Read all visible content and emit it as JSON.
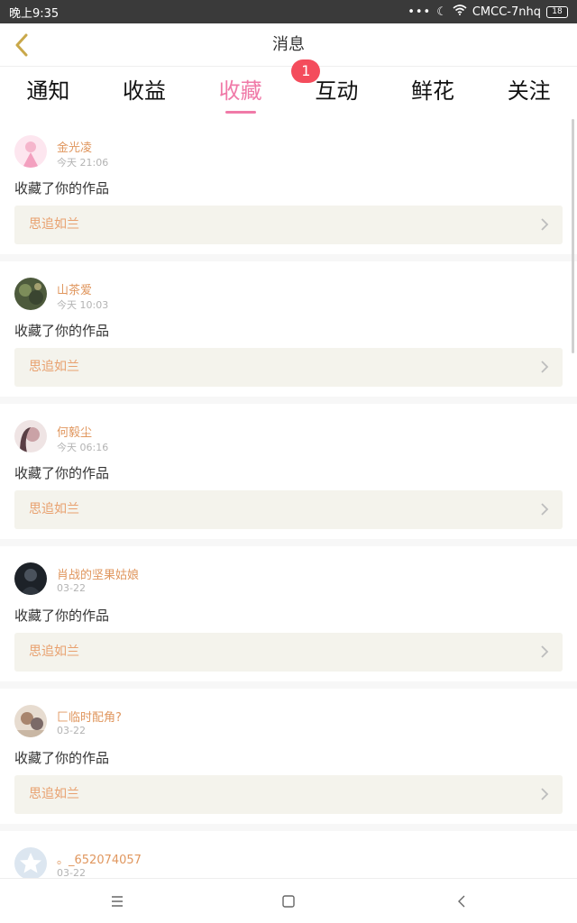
{
  "status": {
    "time": "晚上9:35",
    "carrier": "CMCC-7nhq",
    "battery": "18"
  },
  "header": {
    "title": "消息"
  },
  "tabs": [
    {
      "label": "通知"
    },
    {
      "label": "收益"
    },
    {
      "label": "收藏",
      "active": true,
      "badge": "1"
    },
    {
      "label": "互动"
    },
    {
      "label": "鲜花"
    },
    {
      "label": "关注"
    }
  ],
  "messages": [
    {
      "user": "金光凌",
      "time": "今天 21:06",
      "text": "收藏了你的作品",
      "work": "思追如兰"
    },
    {
      "user": "山茶爱",
      "time": "今天 10:03",
      "text": "收藏了你的作品",
      "work": "思追如兰"
    },
    {
      "user": "何毅尘",
      "time": "今天 06:16",
      "text": "收藏了你的作品",
      "work": "思追如兰"
    },
    {
      "user": "肖战的坚果姑娘",
      "time": "03-22",
      "text": "收藏了你的作品",
      "work": "思追如兰"
    },
    {
      "user": "匚临时配角?",
      "time": "03-22",
      "text": "收藏了你的作品",
      "work": "思追如兰"
    },
    {
      "user": "。_652074057",
      "time": "03-22",
      "text": "",
      "work": ""
    }
  ],
  "colors": {
    "accent": "#f07aa8",
    "username": "#e0975f",
    "work_bg": "#f4f3ec",
    "badge": "#f44c5c"
  },
  "icons": {
    "back": "chevron-left-icon",
    "menu": "menu-icon",
    "home": "home-square-icon",
    "nav_back": "back-arrow-icon"
  }
}
